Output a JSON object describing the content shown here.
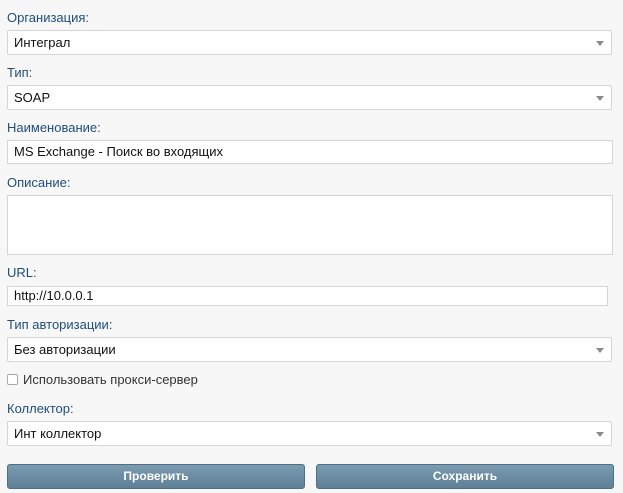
{
  "form": {
    "organization": {
      "label": "Организация:",
      "value": "Интеграл"
    },
    "type": {
      "label": "Тип:",
      "value": "SOAP"
    },
    "name": {
      "label": "Наименование:",
      "value": "MS Exchange - Поиск во входящих"
    },
    "description": {
      "label": "Описание:",
      "value": ""
    },
    "url": {
      "label": "URL:",
      "value": "http://10.0.0.1"
    },
    "auth_type": {
      "label": "Тип авторизации:",
      "value": "Без авторизации"
    },
    "use_proxy": {
      "label": "Использовать прокси-сервер",
      "checked": false
    },
    "collector": {
      "label": "Коллектор:",
      "value": "Инт коллектор"
    }
  },
  "buttons": {
    "check": "Проверить",
    "save": "Сохранить"
  },
  "icons": {
    "select_arrow": "chevron-down-icon"
  }
}
